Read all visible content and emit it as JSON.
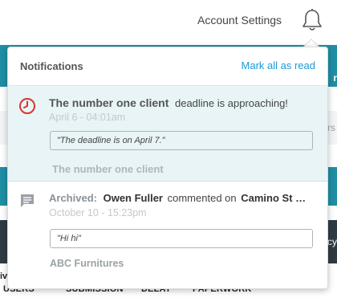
{
  "topbar": {
    "account_settings": "Account Settings",
    "bell_icon": "bell-icon"
  },
  "background": {
    "teal_strip_1_peek": "r",
    "gray_strip_peek": "ers",
    "dark_strip_peek": "cy",
    "footer_left": "iv",
    "columns": [
      "USERS",
      "SUBMISSION",
      "DELAY",
      "PAPERWORK"
    ]
  },
  "notifications": {
    "title": "Notifications",
    "mark_all_read": "Mark all as read",
    "items": [
      {
        "icon": "clock-icon",
        "actor": "The number one client",
        "text": "deadline is approaching!",
        "time": "April 6 - 04:01am",
        "quote": "\"The deadline is on April 7.\"",
        "footer": "The number one client",
        "unread": true
      },
      {
        "icon": "chat-icon",
        "prefix": "Archived:",
        "actor": "Owen Fuller",
        "verb": "commented on",
        "target": "Camino St …",
        "time": "October 10 - 15:23pm",
        "quote": "\"Hi hi\"",
        "footer": "ABC Furnitures",
        "unread": false
      }
    ]
  },
  "colors": {
    "accent_link": "#1a9bd7",
    "unread_bg": "#e8f4f6",
    "clock_red": "#d9342b",
    "teal": "#1f8ea4",
    "dark": "#2f3b44"
  }
}
